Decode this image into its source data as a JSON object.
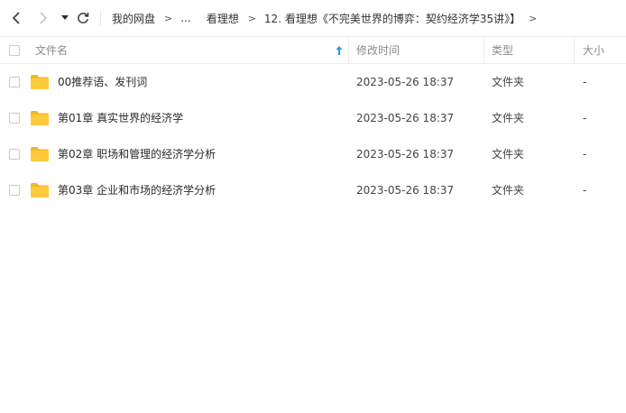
{
  "toolbar": {
    "back_icon": "chevron-left-icon",
    "forward_icon": "chevron-right-icon",
    "history_icon": "caret-down-icon",
    "refresh_icon": "refresh-icon"
  },
  "breadcrumb": {
    "items": [
      "我的网盘",
      "...",
      "看理想",
      "12. 看理想《不完美世界的博弈：契约经济学35讲》】"
    ],
    "separator": ">"
  },
  "table": {
    "columns": {
      "name": "文件名",
      "modified": "修改时间",
      "type": "类型",
      "size": "大小"
    },
    "sort": {
      "column": "name",
      "direction": "ascending"
    },
    "rows": [
      {
        "name": "00推荐语、发刊词",
        "modified": "2023-05-26 18:37",
        "type": "文件夹",
        "size": "-",
        "icon": "folder-icon"
      },
      {
        "name": "第01章 真实世界的经济学",
        "modified": "2023-05-26 18:37",
        "type": "文件夹",
        "size": "-",
        "icon": "folder-icon"
      },
      {
        "name": "第02章 职场和管理的经济学分析",
        "modified": "2023-05-26 18:37",
        "type": "文件夹",
        "size": "-",
        "icon": "folder-icon"
      },
      {
        "name": "第03章 企业和市场的经济学分析",
        "modified": "2023-05-26 18:37",
        "type": "文件夹",
        "size": "-",
        "icon": "folder-icon"
      }
    ]
  },
  "colors": {
    "folder": "#ffc93c",
    "folder_tab": "#f5b52a",
    "sort_arrow": "#1e9be8",
    "header_text": "#8c8c8c"
  }
}
